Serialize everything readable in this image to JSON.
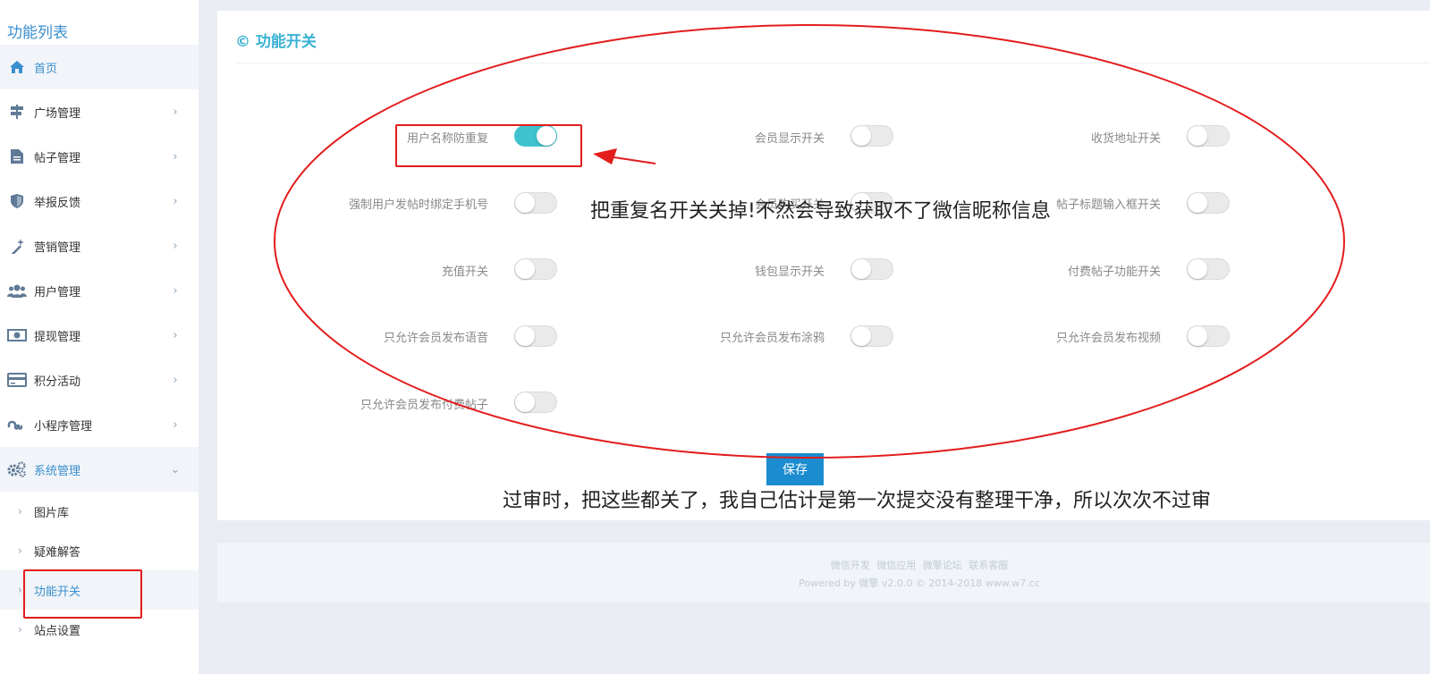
{
  "sidebar": {
    "title": "功能列表",
    "items": [
      {
        "label": "首页",
        "icon": "home-icon"
      },
      {
        "label": "广场管理",
        "icon": "signpost-icon"
      },
      {
        "label": "帖子管理",
        "icon": "document-icon"
      },
      {
        "label": "举报反馈",
        "icon": "shield-icon"
      },
      {
        "label": "营销管理",
        "icon": "magic-wand-icon"
      },
      {
        "label": "用户管理",
        "icon": "users-icon"
      },
      {
        "label": "提现管理",
        "icon": "money-icon"
      },
      {
        "label": "积分活动",
        "icon": "credit-card-icon"
      },
      {
        "label": "小程序管理",
        "icon": "stumbleupon-icon"
      },
      {
        "label": "系统管理",
        "icon": "gears-icon"
      }
    ],
    "sub_items": [
      {
        "label": "图片库"
      },
      {
        "label": "疑难解答"
      },
      {
        "label": "功能开关"
      },
      {
        "label": "站点设置"
      }
    ]
  },
  "panel": {
    "title": "© 功能开关",
    "switches": [
      {
        "label": "用户名称防重复",
        "on": true
      },
      {
        "label": "会员显示开关",
        "on": false
      },
      {
        "label": "收货地址开关",
        "on": false
      },
      {
        "label": "强制用户发帖时绑定手机号",
        "on": false
      },
      {
        "label": "会员购买开关",
        "on": false
      },
      {
        "label": "帖子标题输入框开关",
        "on": false
      },
      {
        "label": "充值开关",
        "on": false
      },
      {
        "label": "钱包显示开关",
        "on": false
      },
      {
        "label": "付费帖子功能开关",
        "on": false
      },
      {
        "label": "只允许会员发布语音",
        "on": false
      },
      {
        "label": "只允许会员发布涂鸦",
        "on": false
      },
      {
        "label": "只允许会员发布视频",
        "on": false
      },
      {
        "label": "只允许会员发布付费帖子",
        "on": false
      }
    ],
    "save_label": "保存"
  },
  "footer": {
    "links": [
      "微信开发",
      "微信应用",
      "微擎论坛",
      "联系客服"
    ],
    "copyright": "Powered by 微擎 v2.0.0 © 2014-2018 www.w7.cc"
  },
  "annotations": {
    "note1": "把重复名开关关掉!不然会导致获取不了微信昵称信息",
    "note2": "过审时，把这些都关了，我自己估计是第一次提交没有整理干净，所以次次不过审"
  },
  "colors": {
    "accent": "#3a8fce",
    "toggle_on": "#3fc2cf",
    "save_button": "#1a8ccf",
    "annotation_red": "#e31c1c"
  }
}
